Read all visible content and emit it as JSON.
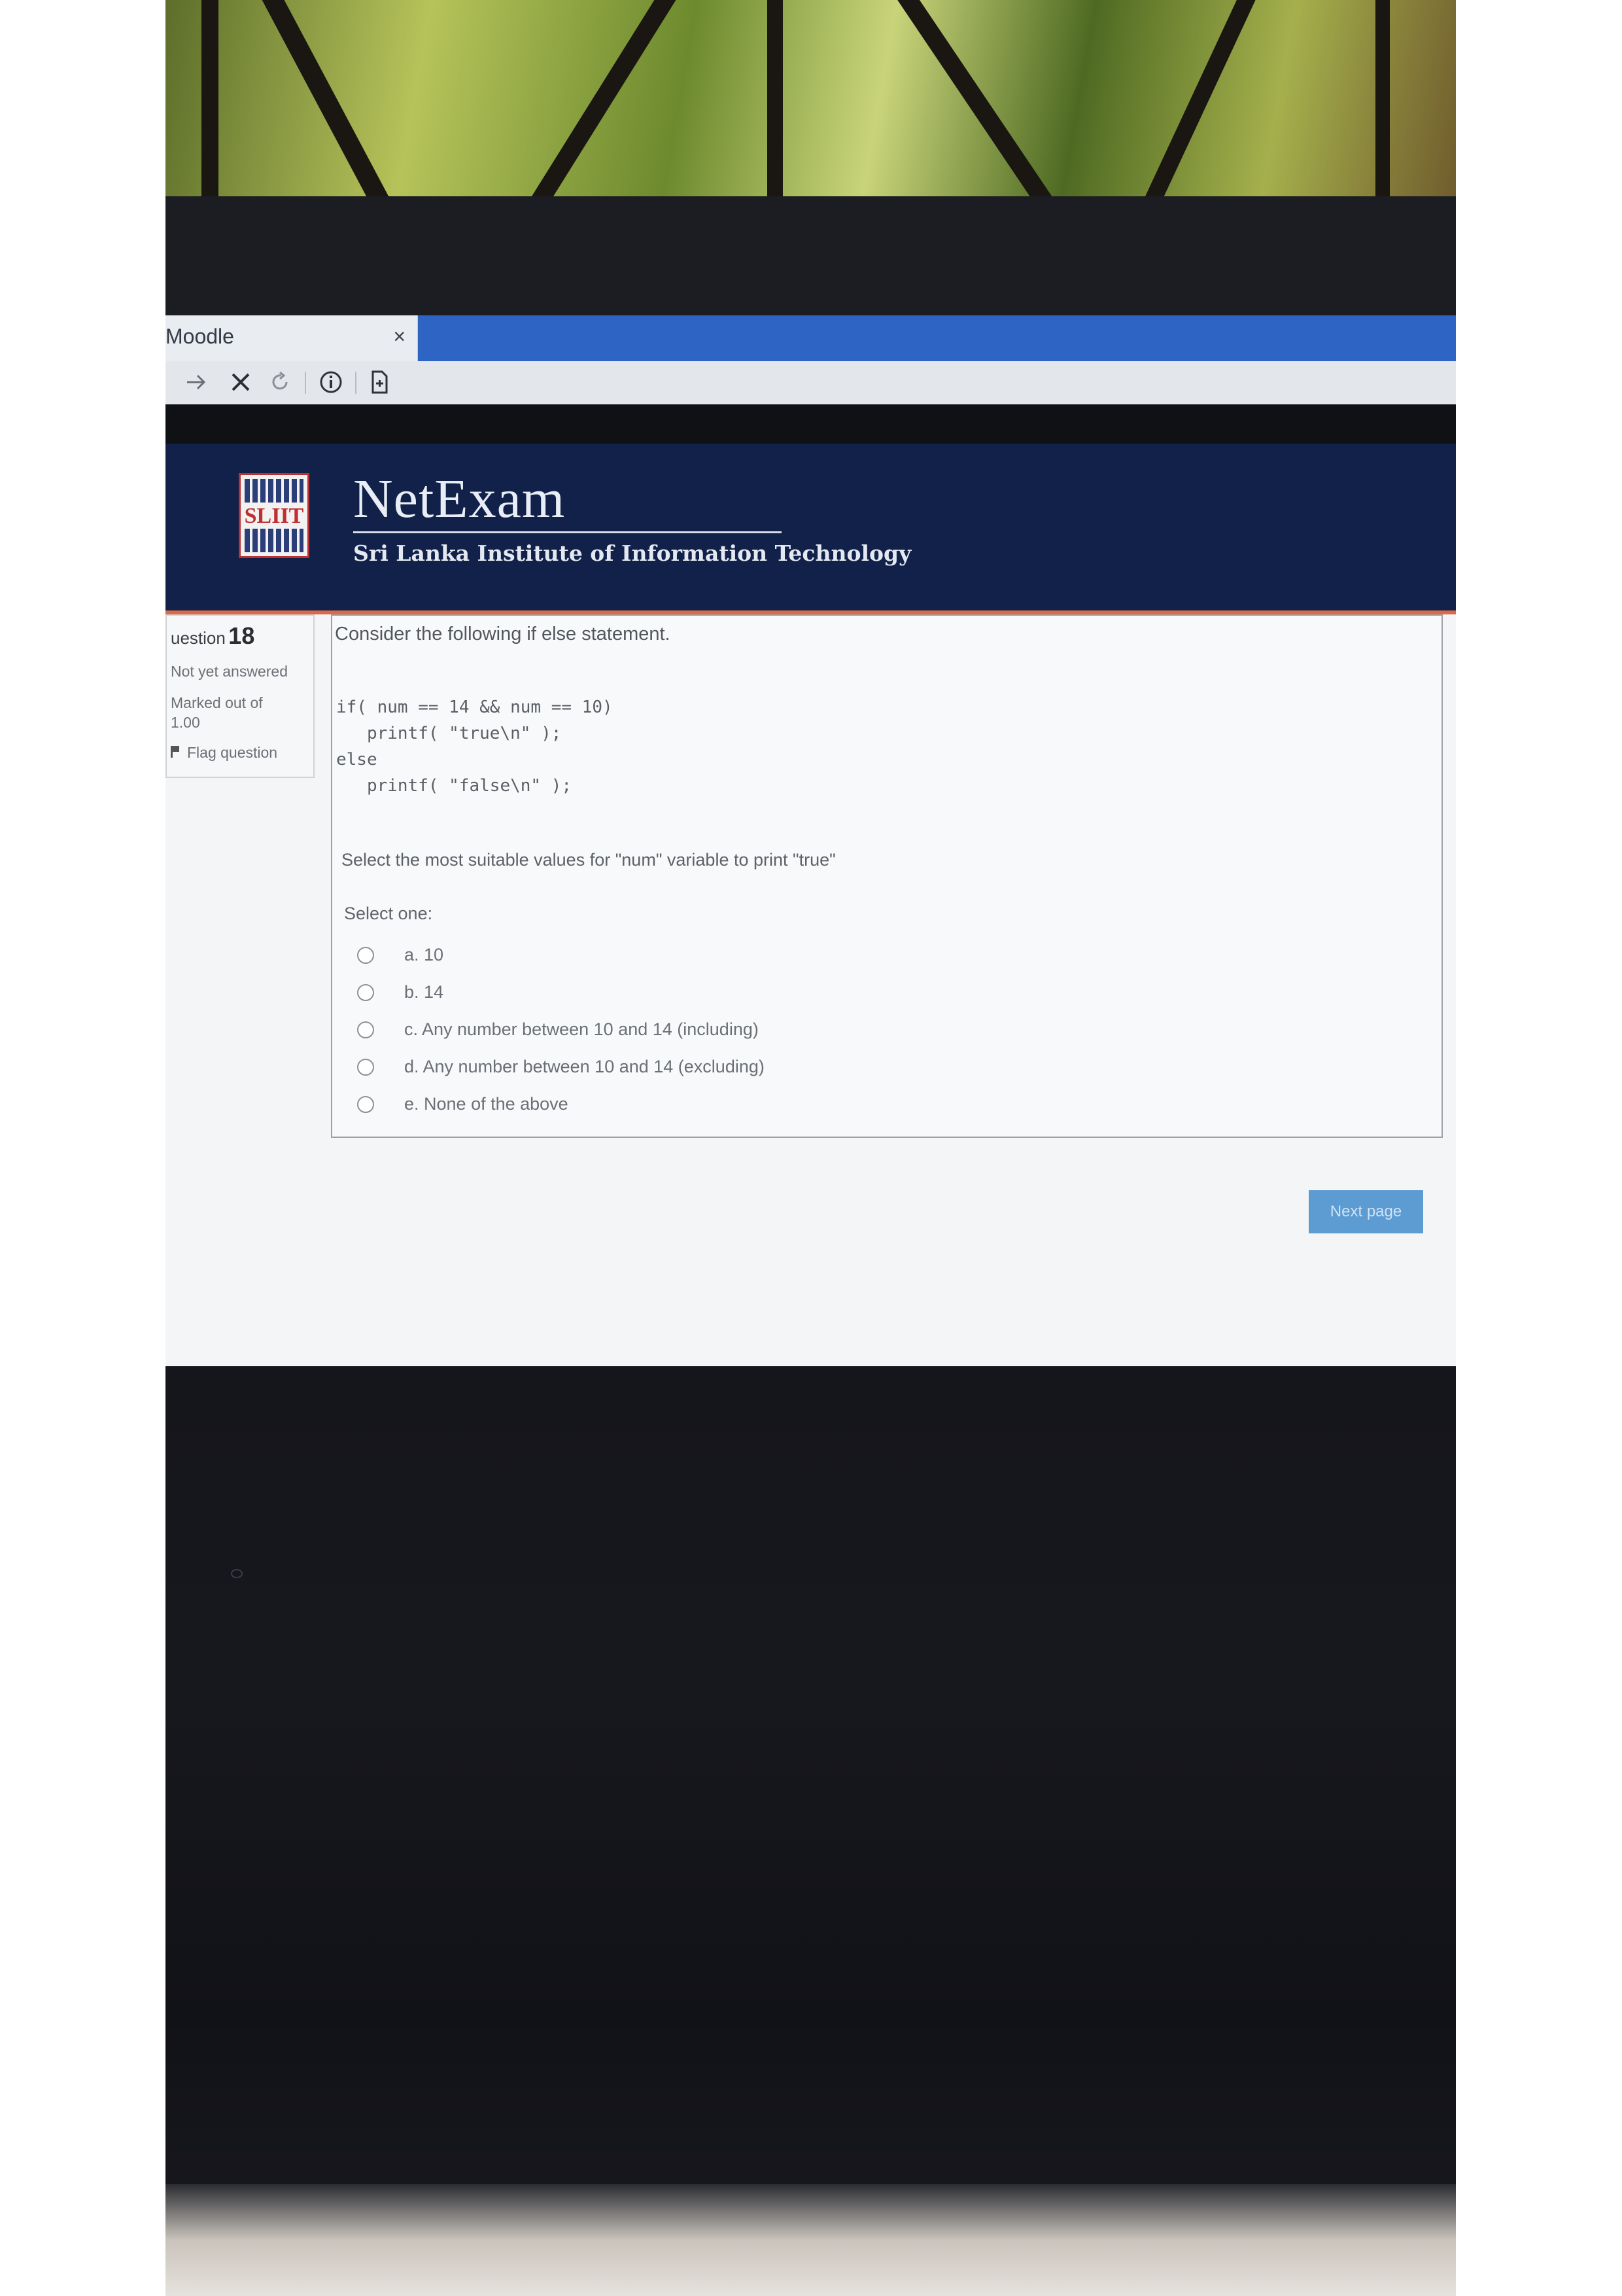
{
  "browser": {
    "tab_title": "Moodle",
    "tab_close": "×",
    "toolbar_icons": [
      "forward-icon",
      "stop-icon",
      "reload-icon",
      "info-icon",
      "page-icon"
    ]
  },
  "site": {
    "logo_text": "SLIIT",
    "title": "NetExam",
    "subtitle": "Sri Lanka Institute of Information Technology"
  },
  "question_info": {
    "label": "uestion",
    "number": "18",
    "status": "Not yet answered",
    "marked_line1": "Marked out of",
    "marked_line2": "1.00",
    "flag_label": "Flag question"
  },
  "question": {
    "intro": "Consider the following if else statement.",
    "code": "if( num == 14 && num == 10)\n   printf( \"true\\n\" );\nelse\n   printf( \"false\\n\" );",
    "prompt": "Select the most suitable  values for \"num\" variable to print \"true\"",
    "select_one": "Select one:",
    "options": [
      "a. 10",
      "b. 14",
      "c. Any number between 10 and 14 (including)",
      "d. Any number between 10 and 14 (excluding)",
      "e. None of the above"
    ]
  },
  "next_button": "Next page",
  "colors": {
    "header_bg": "#11214a",
    "header_accent": "#d96b46",
    "tabbar_blue": "#2e64c4",
    "next_button": "#5d9bd3"
  }
}
